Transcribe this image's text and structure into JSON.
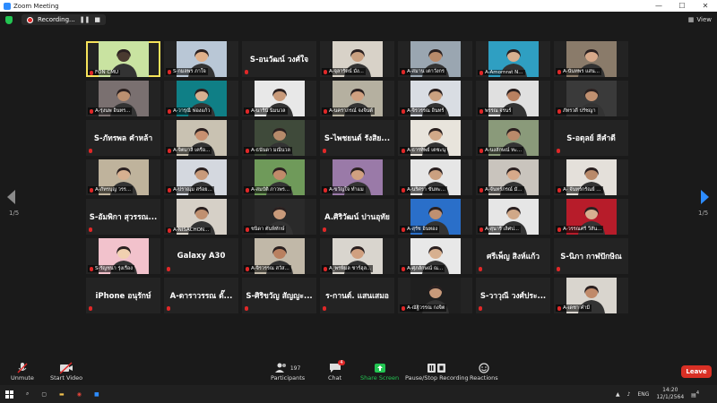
{
  "window": {
    "title": "Zoom Meeting",
    "minimize": "—",
    "maximize": "☐",
    "close": "✕"
  },
  "topbar": {
    "recording_label": "Recording...",
    "view_label": "View"
  },
  "pages": {
    "left": "1/5",
    "right": "1/5"
  },
  "tiles": [
    {
      "type": "video",
      "label": "FON CMU",
      "active": true,
      "bg": "#c9e3a1",
      "skin": "#4a3a30"
    },
    {
      "type": "video",
      "label": "S-กมลพร ภาใจ",
      "bg": "#b9c7d6",
      "skin": "#e0b08a"
    },
    {
      "type": "name",
      "big": "S-อนวัฒน์ วงศ์ใจ"
    },
    {
      "type": "video",
      "label": "A-จุลารัตน์ มั่ง...",
      "bg": "#d8d2c8",
      "skin": "#caa080"
    },
    {
      "type": "video",
      "label": "A-สมาน เตาวังกร",
      "bg": "#9aa6b1",
      "skin": "#b98a6a"
    },
    {
      "type": "video",
      "label": "A-Amornrat N...",
      "bg": "#2f9fc2",
      "skin": "#d8b090"
    },
    {
      "type": "video",
      "label": "A-นันทพร แสน...",
      "bg": "#8a7b6a",
      "skin": "#d7a98a"
    },
    {
      "type": "video",
      "label": "A-รุ่งนพ อินทร...",
      "bg": "#7a7070",
      "skin": "#bb9070"
    },
    {
      "type": "video",
      "label": "A-วารุณี ฟองแก้ว",
      "bg": "#0f7f86",
      "skin": "#d8b090"
    },
    {
      "type": "video",
      "label": "A-นารีนี นิ่มนวล",
      "bg": "#e8e8e8",
      "skin": "#c89a7a"
    },
    {
      "type": "video",
      "label": "A-นคราภรณ์ จงจินต์",
      "bg": "#b5b0a0",
      "skin": "#d0a080"
    },
    {
      "type": "video",
      "label": "A-จิรวรรณ อินทร์",
      "bg": "#d9dde3",
      "skin": "#c9a080"
    },
    {
      "type": "video",
      "label": "พรรณ จรนร์",
      "bg": "#e0e0e0",
      "skin": "#b98060"
    },
    {
      "type": "video",
      "label": "ภัทรวดี ปรัชญา",
      "bg": "#3a3a3a",
      "skin": "#c09070"
    },
    {
      "type": "name",
      "big": "S-ภัทรพล คำหล้า"
    },
    {
      "type": "video",
      "label": "A-จิตมาลี เครือ...",
      "bg": "#c9c2b2",
      "skin": "#c89070"
    },
    {
      "type": "video",
      "label": "A-ธนันดา มณีนวล",
      "bg": "#3f4a3a",
      "skin": "#b68a6a"
    },
    {
      "type": "name",
      "big": "S-ไพชยนต์ รังสิย..."
    },
    {
      "type": "video",
      "label": "A-ธารทิพย์ เตชะนุ",
      "bg": "#e8e4dc",
      "skin": "#d0a888"
    },
    {
      "type": "video",
      "label": "A-นงลักษณ์ ทะ...",
      "bg": "#8a9a7a",
      "skin": "#b98a6a"
    },
    {
      "type": "name",
      "big": "S-อดุลย์ สีคำดี"
    },
    {
      "type": "video",
      "label": "A-ภัทรบุญ วรร...",
      "bg": "#bfb39c",
      "skin": "#d7b090"
    },
    {
      "type": "video",
      "label": "A-ปราณุม สร้อย...",
      "bg": "#d4d8df",
      "skin": "#c89a7a"
    },
    {
      "type": "video",
      "label": "A-สมบัติ ภาวพร...",
      "bg": "#6f9a5a",
      "skin": "#c08a6a"
    },
    {
      "type": "video",
      "label": "A-ขวัญใจ ทำแม",
      "bg": "#9a7aa8",
      "skin": "#d0a080"
    },
    {
      "type": "video",
      "label": "A-นริศรา ขันทะ...",
      "bg": "#e6e6e6",
      "skin": "#caa080"
    },
    {
      "type": "video",
      "label": "A-จันทร์ภรณ์ มั่...",
      "bg": "#c9c4bd",
      "skin": "#d7a98a"
    },
    {
      "type": "video",
      "label": "A- จันทร์กรัณย์ ...",
      "bg": "#e4e0da",
      "skin": "#b98a6a"
    },
    {
      "type": "name",
      "big": "S-อัมพิกา สุวรรณ..."
    },
    {
      "type": "video",
      "label": "A-NISACHON...",
      "bg": "#d6d0c7",
      "skin": "#c09070"
    },
    {
      "type": "video",
      "label": "ชนิดา ตันพิทักษ์",
      "bg": "#2a2a2a",
      "skin": "#c89a7a"
    },
    {
      "type": "name",
      "big": "A.ศิริวัฒน์ ปานอุทัย"
    },
    {
      "type": "video",
      "label": "A-สุรัช อินทอง",
      "bg": "#2a6fc9",
      "skin": "#c09070"
    },
    {
      "type": "video",
      "label": "A-สุนารี เลิศป...",
      "bg": "#e6e6e6",
      "skin": "#d0a888"
    },
    {
      "type": "video",
      "label": "A-วรรณศรี วีสัน...",
      "bg": "#b71c2a",
      "skin": "#d7b090"
    },
    {
      "type": "video",
      "label": "S-รัญชนา รุ่งเรือง",
      "bg": "#f2c2cc",
      "skin": "#f1d0b0"
    },
    {
      "type": "name",
      "big": "Galaxy A30"
    },
    {
      "type": "video",
      "label": "A-จิรวรรณ สวัส...",
      "bg": "#c1b8a8",
      "skin": "#b98060"
    },
    {
      "type": "video",
      "label": "A_พรพิมล ชาร์ฮุล...",
      "bg": "#d9d5ce",
      "skin": "#d0a080"
    },
    {
      "type": "video",
      "label": "A-ศุภลักษณ์ ณ...",
      "bg": "#e8e8e8",
      "skin": "#d7b090"
    },
    {
      "type": "name",
      "big": "ศรีเพ็ญ สิงห์แก้ว"
    },
    {
      "type": "name",
      "big": "S-นิภา กาฬปักษิณ"
    },
    {
      "type": "name",
      "big": "iPhone อนุรักษ์"
    },
    {
      "type": "name",
      "big": "A-ดาราวรรณ ตั๊..."
    },
    {
      "type": "name",
      "big": "S-ศิริขวัญ สัญญะ..."
    },
    {
      "type": "name",
      "big": "ร-กานต์. แสนเสมอ"
    },
    {
      "type": "video",
      "label": "A-ณัฐิวรรณ กงจิต",
      "bg": "#1f1f1f",
      "skin": "#c89a7a"
    },
    {
      "type": "name",
      "big": "S-วาวุณี วงศ์ประ..."
    },
    {
      "type": "video",
      "label": "A-เดชา คำมี",
      "bg": "#d9d5ce",
      "skin": "#c08a6a"
    }
  ],
  "toolbar": {
    "unmute": "Unmute",
    "start_video": "Start Video",
    "participants": "Participants",
    "participants_count": "197",
    "chat": "Chat",
    "chat_badge": "4",
    "share": "Share Screen",
    "pause_stop": "Pause/Stop Recording",
    "reactions": "Reactions",
    "leave": "Leave"
  },
  "taskbar": {
    "lang": "ENG",
    "time": "14:20",
    "date": "12/1/2564",
    "notif": "4"
  },
  "colors": {
    "accent": "#2d8cff",
    "leave": "#d93025",
    "mic_muted": "#e02828",
    "share_green": "#23c552",
    "active_outline": "#f6e35a"
  }
}
